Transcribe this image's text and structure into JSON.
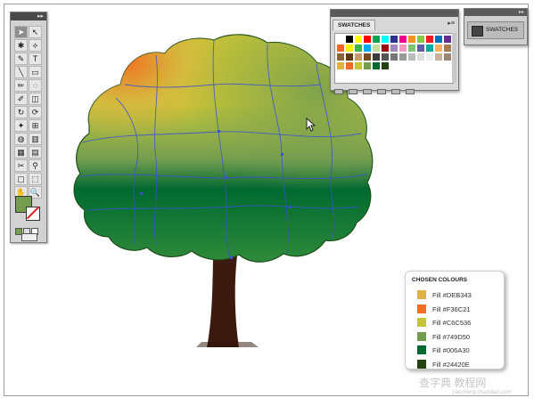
{
  "swatches_panel": {
    "tab_label": "SWATCHES",
    "menu_glyph": "▸≡",
    "colors": [
      "#ffffff",
      "#000000",
      "#ffff00",
      "#ff0000",
      "#00a651",
      "#00ffff",
      "#2e3192",
      "#ec008c",
      "#f7941d",
      "#8dc63f",
      "#ed1c24",
      "#0072bc",
      "#662d91",
      "#f26522",
      "#fff200",
      "#39b54a",
      "#00aeef",
      "#c4df9b",
      "#9e0b0f",
      "#a186be",
      "#f49ac2",
      "#7cc576",
      "#605ca8",
      "#00a99d",
      "#fbaf5d",
      "#a67c52",
      "#8c6239",
      "#603913",
      "#c69c6d",
      "#754c24",
      "#3b3b3b",
      "#555555",
      "#777777",
      "#999999",
      "#bbbbbb",
      "#dddddd",
      "#eeeeee",
      "#c7b299",
      "#998675",
      "#DEB343",
      "#F36C21",
      "#C6C536",
      "#749D50",
      "#006A30",
      "#24420E"
    ]
  },
  "dock_panel": {
    "label": "SWATCHES",
    "grip": "▸▸"
  },
  "chosen_colours": {
    "title": "CHOSEN COLOURS",
    "items": [
      {
        "label": "Fill  #DEB343",
        "color": "#DEB343"
      },
      {
        "label": "Fill  #F36C21",
        "color": "#F36C21"
      },
      {
        "label": "Fill  #C6C536",
        "color": "#C6C536"
      },
      {
        "label": "Fill  #749D50",
        "color": "#749D50"
      },
      {
        "label": "Fill  #006A30",
        "color": "#006A30"
      },
      {
        "label": "Fill  #24420E",
        "color": "#24420E"
      }
    ]
  },
  "tools_panel": {
    "grip": "▸▸",
    "tools": [
      "➤",
      "↖",
      "✱",
      "⟡",
      "✎",
      "T",
      "╲",
      "▭",
      "✏",
      "◌",
      "✐",
      "◫",
      "↻",
      "⟳",
      "✦",
      "⊞",
      "◍",
      "▥",
      "▦",
      "▤",
      "✂",
      "⚲",
      "▢",
      "⬚",
      "✋",
      "🔍"
    ]
  },
  "watermark": {
    "text": "查字典 教程网",
    "sub": "jiaocheng.chazidian.com"
  }
}
